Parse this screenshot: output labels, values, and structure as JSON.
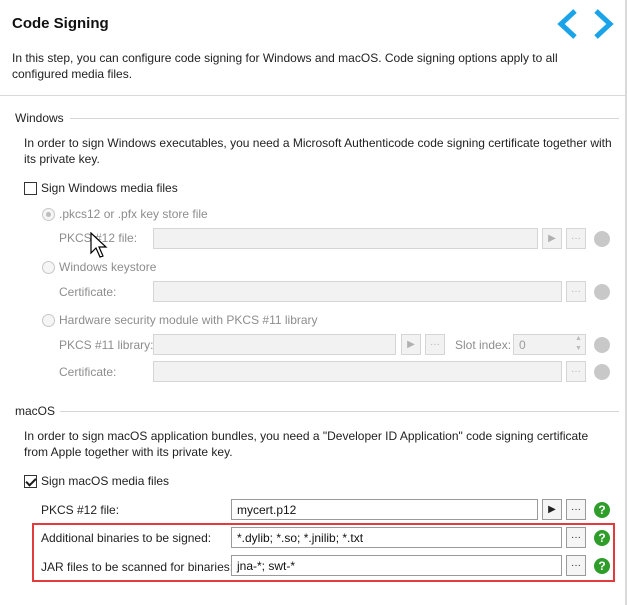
{
  "header": {
    "title": "Code Signing",
    "description": "In this step, you can configure code signing for Windows and macOS. Code signing options apply to all configured media files."
  },
  "windows": {
    "section_title": "Windows",
    "info": "In order to sign Windows executables, you need a Microsoft Authenticode code signing certificate together with its private key.",
    "sign_label": "Sign Windows media files",
    "sign_checked": false,
    "option_pkcs12": ".pkcs12 or .pfx key store file",
    "pkcs12_file_label": "PKCS #12 file:",
    "option_keystore": "Windows keystore",
    "certificate_label": "Certificate:",
    "option_hsm": "Hardware security module with PKCS #11 library",
    "pkcs11_library_label": "PKCS #11 library:",
    "slot_index_label": "Slot index:",
    "slot_index_value": "0",
    "certificate2_label": "Certificate:"
  },
  "macos": {
    "section_title": "macOS",
    "info": "In order to sign macOS application bundles, you need a \"Developer ID Application\" code signing certificate from Apple together with its private key.",
    "sign_label": "Sign macOS media files",
    "sign_checked": true,
    "pkcs12_file_label": "PKCS #12 file:",
    "pkcs12_file_value": "mycert.p12",
    "additional_binaries_label": "Additional binaries to be signed:",
    "additional_binaries_value": "*.dylib; *.so; *.jnilib; *.txt",
    "jar_files_label": "JAR files to be scanned for binaries:",
    "jar_files_value": "jna-*; swt-*"
  },
  "icons": {
    "nav_back": "chevron-left-icon",
    "nav_forward": "chevron-right-icon",
    "help": "question-icon",
    "browse": "ellipsis-icon",
    "play": "play-icon"
  },
  "colors": {
    "accent_blue": "#1aa3e8",
    "help_green": "#2e9d2a",
    "highlight_red": "#e23b3b"
  },
  "glyphs": {
    "ellipsis": "···",
    "play": "▶",
    "help": "?",
    "spin_up": "▲",
    "spin_down": "▼"
  }
}
